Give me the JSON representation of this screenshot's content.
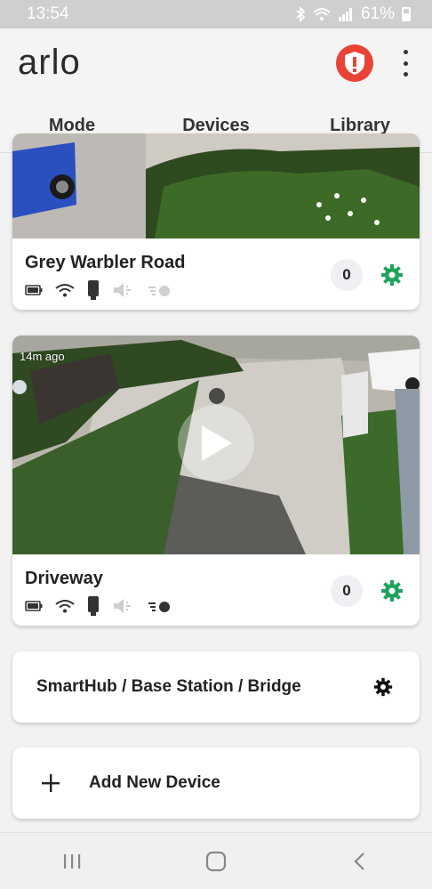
{
  "status_bar": {
    "time": "13:54",
    "battery_percent": "61%",
    "icons": [
      "bluetooth-icon",
      "wifi-icon",
      "signal-icon",
      "battery-icon"
    ]
  },
  "header": {
    "logo_text": "arlo",
    "alert_icon": "shield-alert-icon",
    "menu_icon": "more-vertical-icon"
  },
  "tabs": [
    {
      "label": "Mode",
      "active": false
    },
    {
      "label": "Devices",
      "active": true
    },
    {
      "label": "Library",
      "active": false
    }
  ],
  "cameras": [
    {
      "name": "Grey Warbler Road",
      "event_count": "0",
      "icons": [
        "battery-icon",
        "wifi-icon",
        "power-plug-icon",
        "speaker-muted-icon",
        "motion-toggle-icon"
      ]
    },
    {
      "name": "Driveway",
      "snapshot_age": "14m ago",
      "event_count": "0",
      "icons": [
        "battery-icon",
        "wifi-icon",
        "power-plug-icon",
        "speaker-muted-icon",
        "motion-toggle-icon"
      ]
    }
  ],
  "base_station": {
    "label": "SmartHub / Base Station / Bridge",
    "icon": "gear-icon"
  },
  "add_device": {
    "label": "Add New Device",
    "icon": "plus-icon"
  },
  "colors": {
    "accent_green": "#2bb673",
    "alert_red": "#ea4335",
    "gear_green": "#1fa35c"
  },
  "nav_bar": {
    "icons": [
      "recent-apps-icon",
      "home-icon",
      "back-icon"
    ]
  }
}
